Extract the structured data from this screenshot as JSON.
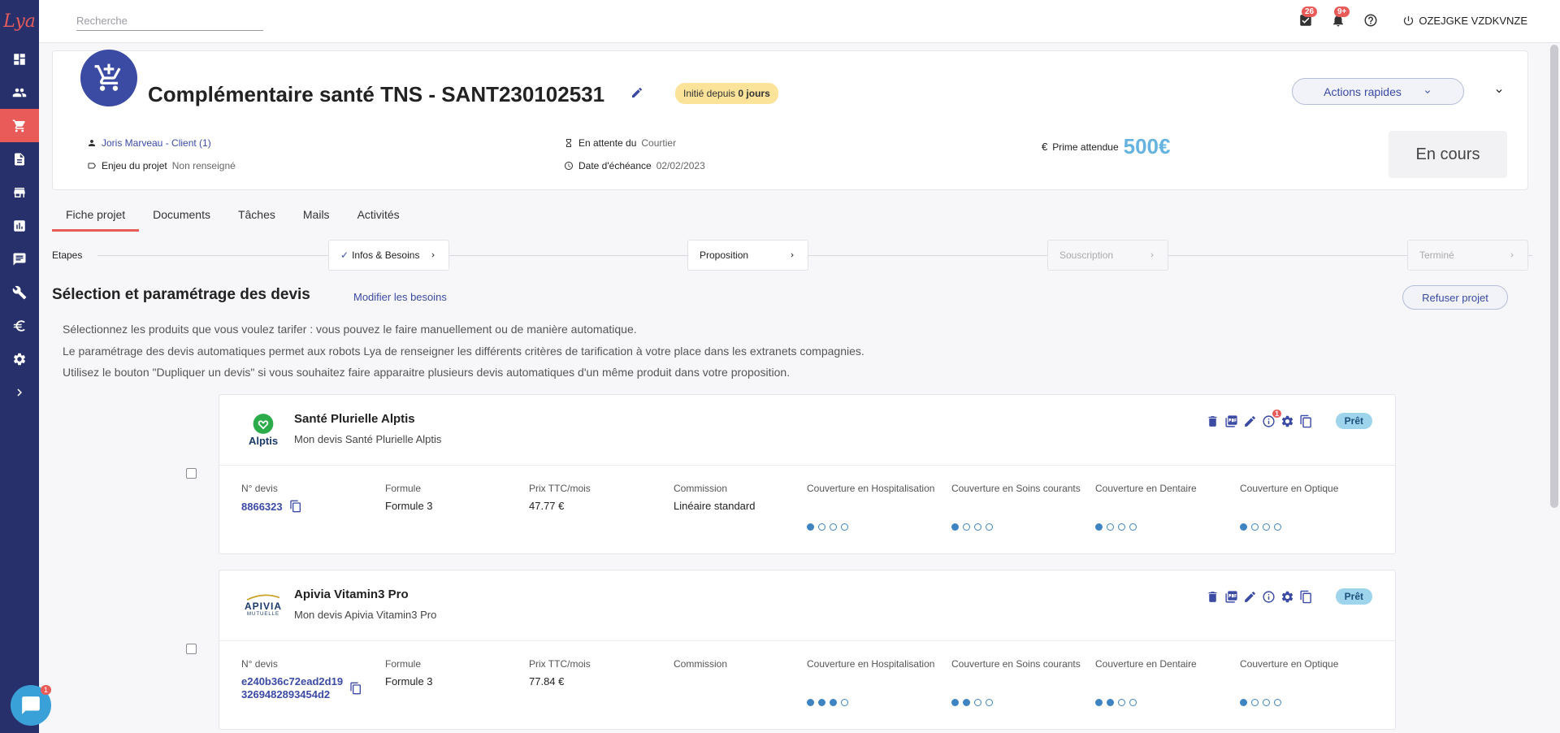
{
  "app": {
    "logo": "Lya"
  },
  "search": {
    "placeholder": "Recherche"
  },
  "topbar": {
    "tasks_badge": "26",
    "notif_badge": "9+",
    "user_name": "OZEJGKE VZDKVNZE"
  },
  "project": {
    "title": "Complémentaire santé TNS - SANT230102531",
    "init_label": "Initié depuis",
    "init_value": "0 jours",
    "actions_label": "Actions rapides",
    "client": "Joris Marveau - Client (1)",
    "enjeu_label": "Enjeu du projet",
    "enjeu_value": "Non renseigné",
    "attente_label": "En attente du",
    "attente_value": "Courtier",
    "echeance_label": "Date d'échéance",
    "echeance_value": "02/02/2023",
    "prime_label": "Prime attendue",
    "prime_value": "500€",
    "status": "En cours"
  },
  "tabs": [
    "Fiche projet",
    "Documents",
    "Tâches",
    "Mails",
    "Activités"
  ],
  "steps": {
    "label": "Etapes",
    "items": [
      "Infos & Besoins",
      "Proposition",
      "Souscription",
      "Terminé"
    ]
  },
  "section": {
    "title": "Sélection et paramétrage des devis",
    "modify_link": "Modifier les besoins",
    "refuse_button": "Refuser projet",
    "info": [
      "Sélectionnez les produits que vous voulez tarifer : vous pouvez le faire manuellement ou de manière automatique.",
      "Le paramétrage des devis automatiques permet aux robots Lya de renseigner les différents critères de tarification à votre place dans les extranets compagnies.",
      "Utilisez le bouton \"Dupliquer un devis\" si vous souhaitez faire apparaitre plusieurs devis automatiques d'un même produit dans votre proposition."
    ]
  },
  "columns": {
    "devis": "N° devis",
    "formule": "Formule",
    "prix": "Prix TTC/mois",
    "commission": "Commission",
    "hospit": "Couverture en Hospitalisation",
    "soins": "Couverture en Soins courants",
    "dentaire": "Couverture en Dentaire",
    "optique": "Couverture en Optique"
  },
  "quotes": [
    {
      "logo_text": "Alptis",
      "name": "Santé Plurielle Alptis",
      "subtitle": "Mon devis Santé Plurielle Alptis",
      "status": "Prêt",
      "info_badge": "1",
      "devis": "8866323",
      "formule": "Formule 3",
      "prix": "47.77 €",
      "commission": "Linéaire standard",
      "levels": {
        "hospit": 1,
        "soins": 1,
        "dentaire": 1,
        "optique": 1
      }
    },
    {
      "logo_text": "APIVIA",
      "logo_sub": "MUTUELLE",
      "name": "Apivia Vitamin3 Pro",
      "subtitle": "Mon devis Apivia Vitamin3 Pro",
      "status": "Prêt",
      "devis_line1": "e240b36c72ead2d19",
      "devis_line2": "3269482893454d2",
      "formule": "Formule 3",
      "prix": "77.84 €",
      "commission": "",
      "levels": {
        "hospit": 3,
        "soins": 2,
        "dentaire": 2,
        "optique": 1
      }
    }
  ],
  "chat": {
    "badge": "1"
  },
  "colors": {
    "sidebar": "#27306b",
    "accent": "#e85b58",
    "primary": "#3b4aa3",
    "dots": "#3f84c2"
  }
}
